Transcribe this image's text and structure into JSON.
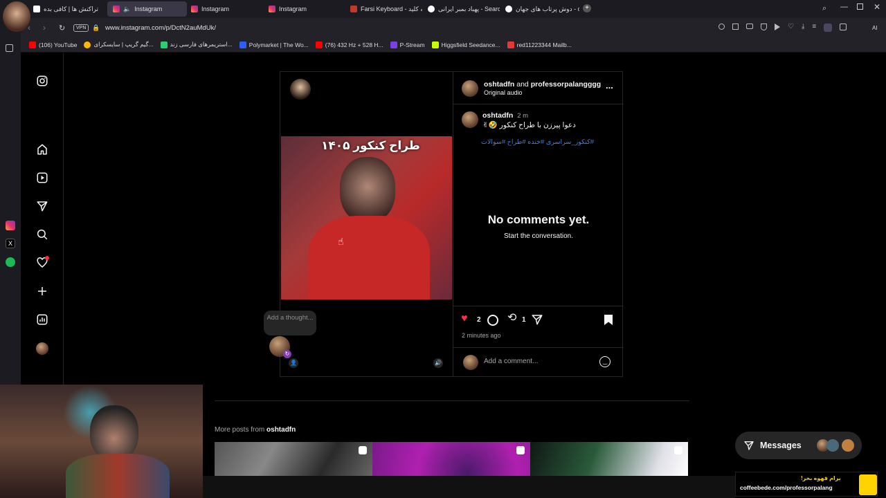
{
  "tabs": [
    {
      "label": "تراکنش ها | کافی بده",
      "active": false
    },
    {
      "label": "Instagram",
      "active": true
    },
    {
      "label": "Instagram",
      "active": false
    },
    {
      "label": "Instagram",
      "active": false
    },
    {
      "label": "Farsi Keyboard - صفحه کلید",
      "active": false
    },
    {
      "label": "پهباد بمبر ایرانی - Search",
      "active": false
    },
    {
      "label": "دوش پرتاب های جهان - ch",
      "active": false
    }
  ],
  "address": {
    "url": "www.instagram.com/p/DctN2auMdUk/",
    "vpn_label": "VPN",
    "ai_label": "AI"
  },
  "bookmarks": [
    {
      "label": "(106) YouTube",
      "color": "#ff0000"
    },
    {
      "label": "گیم گریپ | سایسکرای...",
      "color": "#ffb800"
    },
    {
      "label": "استریمرهای فارسی زند...",
      "color": "#2ecc71"
    },
    {
      "label": "Polymarket | The Wo...",
      "color": "#2e5cff"
    },
    {
      "label": "(76) 432 Hz + 528 H...",
      "color": "#ff0000"
    },
    {
      "label": "P-Stream",
      "color": "#7b3fe4"
    },
    {
      "label": "Higgsfield Seedance...",
      "color": "#c6ff00"
    },
    {
      "label": "red11223344 Mailb...",
      "color": "#e53935"
    }
  ],
  "post": {
    "header_user1": "oshtadfn",
    "header_and": "and",
    "header_user2": "professorpalangggg",
    "audio": "Original audio",
    "more": "...",
    "caption_user": "oshtadfn",
    "caption_time": "2 m",
    "caption_text": "دعوا پیرزن با طراح کنکور 🤣✌",
    "hashtags": "#کنکور_سراسری #خنده #طراح #سوالات",
    "video_overlay": "طراح کنکور ۱۴۰۵",
    "thought_placeholder": "Add a thought...",
    "empty_title": "No comments yet.",
    "empty_sub": "Start the conversation.",
    "likes": "2",
    "reposts": "1",
    "time_ago": "2 minutes ago",
    "comment_placeholder": "Add a comment..."
  },
  "more_posts": {
    "prefix": "More posts from",
    "user": "oshtadfn"
  },
  "messages_label": "Messages",
  "promo": {
    "line1": "برام قهوه بخر!",
    "line2": "coffeebede.com/professorpalang"
  },
  "colors": {
    "like": "#ff3040",
    "link": "#4a7fd4",
    "accent": "#e1306c"
  }
}
